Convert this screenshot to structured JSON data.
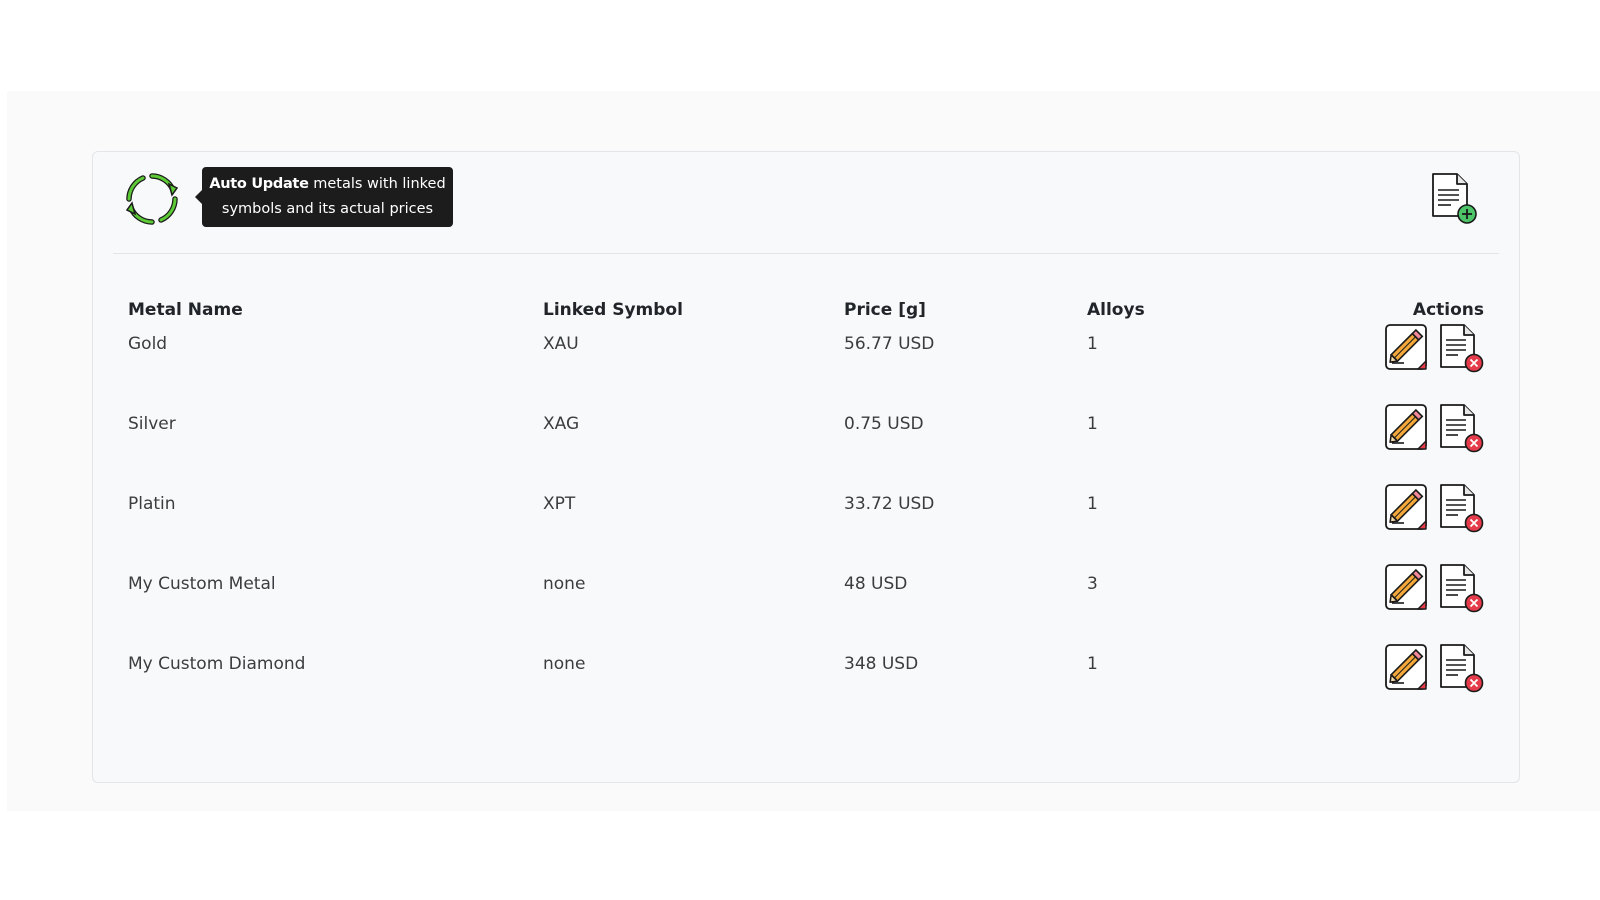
{
  "header": {
    "tooltip_bold": "Auto Update",
    "tooltip_rest": " metals with linked symbols and its actual prices"
  },
  "table": {
    "columns": [
      "Metal Name",
      "Linked Symbol",
      "Price [g]",
      "Alloys",
      "Actions"
    ],
    "rows": [
      {
        "name": "Gold",
        "symbol": "XAU",
        "price": "56.77 USD",
        "alloys": "1"
      },
      {
        "name": "Silver",
        "symbol": "XAG",
        "price": "0.75 USD",
        "alloys": "1"
      },
      {
        "name": "Platin",
        "symbol": "XPT",
        "price": "33.72 USD",
        "alloys": "1"
      },
      {
        "name": "My Custom Metal",
        "symbol": "none",
        "price": "48 USD",
        "alloys": "3"
      },
      {
        "name": "My Custom Diamond",
        "symbol": "none",
        "price": "348 USD",
        "alloys": "1"
      }
    ]
  },
  "icons": {
    "refresh": "refresh-icon",
    "add": "add-document-icon",
    "edit": "edit-pencil-icon",
    "delete": "delete-document-icon"
  },
  "colors": {
    "refresh_green": "#5cc936",
    "add_green": "#4cc467",
    "delete_red": "#e63b4a",
    "pencil_orange": "#f4a83a",
    "tooltip_bg": "#1c1c1c"
  }
}
